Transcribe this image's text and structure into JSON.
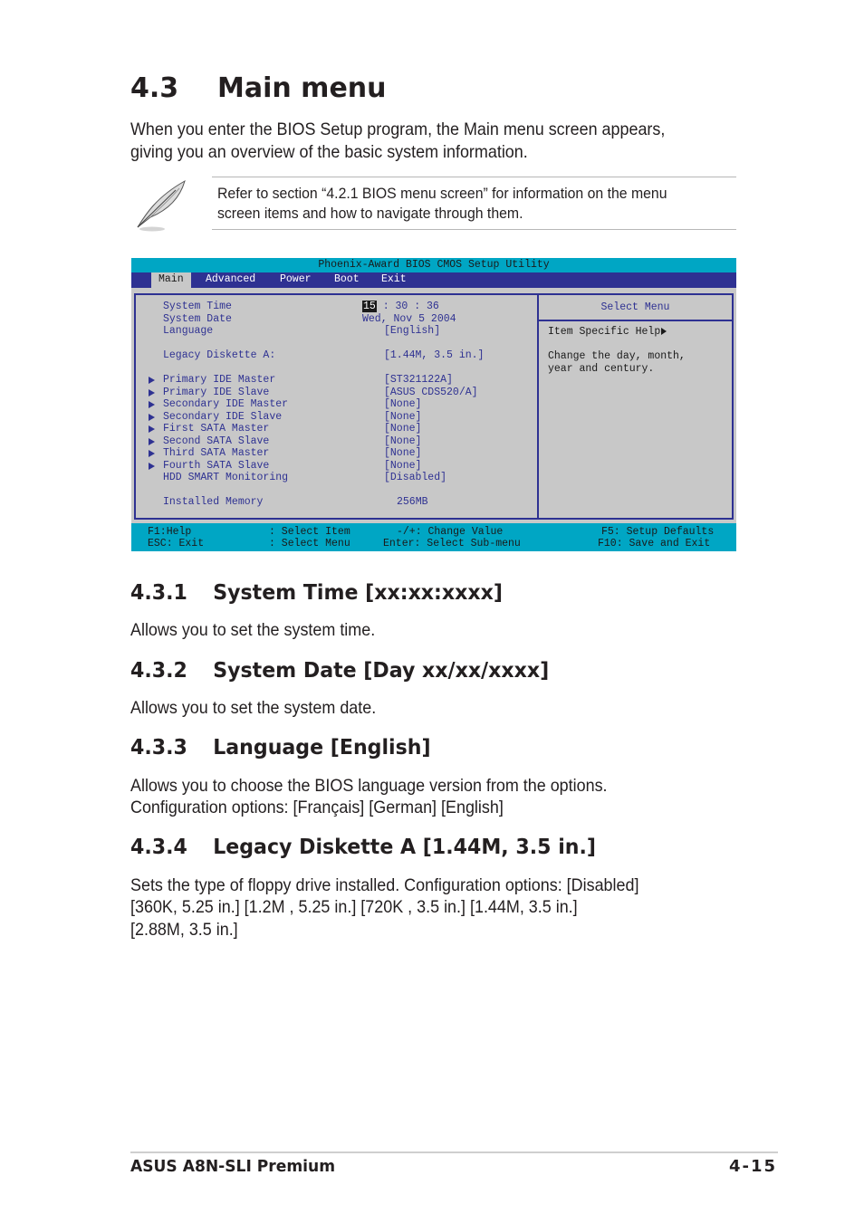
{
  "section": {
    "number": "4.3",
    "title": "Main menu",
    "intro_lines": [
      "When you enter the BIOS Setup program, the Main menu screen appears,",
      "giving you an overview of the basic system information."
    ]
  },
  "note": {
    "icon": "quill-pen-icon",
    "lines": [
      "Refer to section “4.2.1  BIOS menu screen” for information on the menu",
      "screen items and how to navigate through them."
    ]
  },
  "bios": {
    "title": "Phoenix-Award BIOS CMOS Setup Utility",
    "tabs": [
      {
        "label": "Main",
        "active": true
      },
      {
        "label": "Advanced",
        "active": false
      },
      {
        "label": "Power",
        "active": false
      },
      {
        "label": "Boot",
        "active": false
      },
      {
        "label": "Exit",
        "active": false
      }
    ],
    "time": {
      "label": "System Time",
      "hour": "15",
      "rest": " : 30 : 36"
    },
    "date": {
      "label": "System Date",
      "value": "Wed, Nov 5 2004"
    },
    "language": {
      "label": "Language",
      "value": "[English]"
    },
    "diskette": {
      "label": "Legacy Diskette A:",
      "value": "[1.44M, 3.5 in.]"
    },
    "devices": [
      {
        "label": "Primary IDE Master",
        "value": "[ST321122A]",
        "submenu": true
      },
      {
        "label": "Primary IDE Slave",
        "value": "[ASUS CDS520/A]",
        "submenu": true
      },
      {
        "label": "Secondary IDE Master",
        "value": "[None]",
        "submenu": true
      },
      {
        "label": "Secondary IDE Slave",
        "value": "[None]",
        "submenu": true
      },
      {
        "label": "First SATA Master",
        "value": "[None]",
        "submenu": true
      },
      {
        "label": "Second SATA Slave",
        "value": "[None]",
        "submenu": true
      },
      {
        "label": "Third SATA Master",
        "value": "[None]",
        "submenu": true
      },
      {
        "label": "Fourth SATA Slave",
        "value": "[None]",
        "submenu": true
      },
      {
        "label": "HDD SMART Monitoring",
        "value": "[Disabled]",
        "submenu": false
      }
    ],
    "memory": {
      "label": "Installed Memory",
      "value": "256MB"
    },
    "help": {
      "header": "Select Menu",
      "item_help": "Item Specific Help",
      "lines": [
        "Change the day, month,",
        "year and century."
      ]
    },
    "footer": {
      "f1": "F1:Help",
      "esc": "ESC: Exit",
      "select_item": ": Select Item",
      "select_menu": ": Select Menu",
      "change_value": "-/+: Change Value",
      "enter": "Enter: Select Sub-menu",
      "f5": "F5: Setup Defaults",
      "f10": "F10: Save and Exit"
    },
    "colors": {
      "title_bar": "#00a6c4",
      "menu_bar": "#2e3192",
      "panel": "#c8c8c8",
      "text": "#2e3192"
    }
  },
  "subsections": [
    {
      "number": "4.3.1",
      "title": "System Time [xx:xx:xxxx]",
      "lines": [
        "Allows you to set the system time."
      ]
    },
    {
      "number": "4.3.2",
      "title": "System Date [Day xx/xx/xxxx]",
      "lines": [
        "Allows you to set the system date."
      ]
    },
    {
      "number": "4.3.3",
      "title": "Language [English]",
      "lines": [
        "Allows you to choose the BIOS language version from the options.",
        "Configuration options: [Français] [German] [English]"
      ]
    },
    {
      "number": "4.3.4",
      "title": "Legacy Diskette A [1.44M, 3.5 in.]",
      "lines": [
        "Sets the type of floppy drive installed. Configuration options: [Disabled]",
        "[360K, 5.25 in.] [1.2M , 5.25 in.] [720K , 3.5 in.] [1.44M, 3.5 in.]",
        "[2.88M, 3.5  in.]"
      ]
    }
  ],
  "footer": {
    "product": "ASUS A8N-SLI Premium",
    "page": "4-15"
  }
}
